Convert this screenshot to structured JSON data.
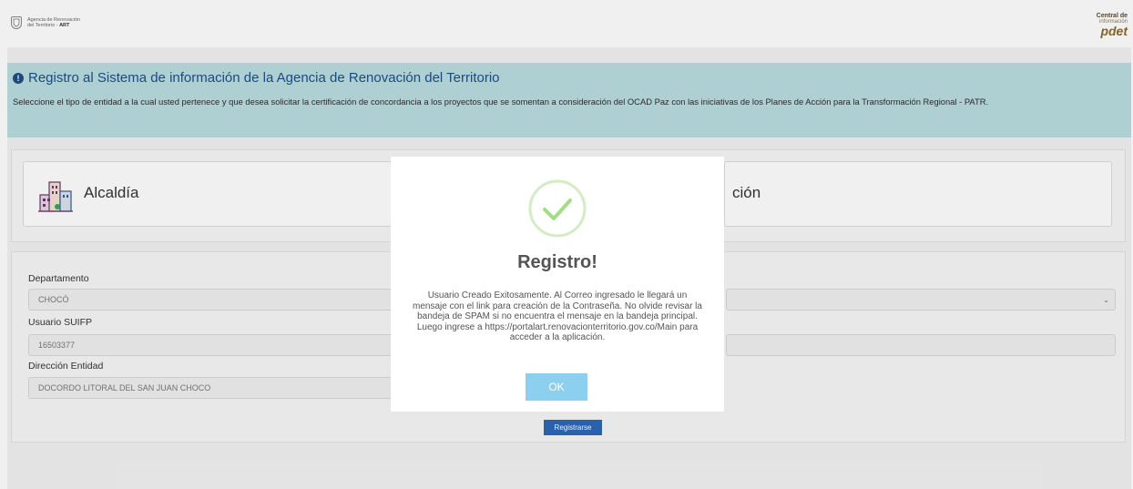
{
  "header": {
    "left_logo": {
      "line1": "Agencia de Renovación",
      "line2": "del Territorio - ",
      "line2_bold": "ART"
    },
    "right_logo": {
      "line1": "Central de",
      "line2": "información",
      "line3": "pdet"
    }
  },
  "banner": {
    "title": "Registro al Sistema de información de la Agencia de Renovación del Territorio",
    "text": "Seleccione el tipo de entidad a la cual usted pertenece y que desea solicitar la certificación de concordancia a los proyectos que se somentan a consideración del OCAD Paz con las iniciativas de los Planes de Acción para la Transformación Regional - PATR."
  },
  "entities": [
    {
      "label": "Alcaldía",
      "icon": "building-icon"
    },
    {
      "label": "ción"
    }
  ],
  "form": {
    "departamento_label": "Departamento",
    "departamento_value": "CHOCÓ",
    "usuario_label": "Usuario SUIFP",
    "usuario_value": "16503377",
    "direccion_label": "Dirección Entidad",
    "direccion_value": "DOCORDO LITORAL DEL SAN JUAN CHOCO",
    "register_button": "Registrarse"
  },
  "modal": {
    "title": "Registro!",
    "message": "Usuario Creado Exitosamente. Al Correo ingresado le llegará un mensaje con el link para creación de la Contraseña. No olvide revisar la bandeja de SPAM si no encuentra el mensaje en la bandeja principal. Luego ingrese a https://portalart.renovacionterritorio.gov.co/Main para acceder a la aplicación.",
    "ok_button": "OK"
  },
  "colors": {
    "banner_bg": "#b9dde1",
    "title_blue": "#1d4f8a",
    "success_green": "#a5dc86",
    "ok_button": "#8ccfee",
    "register_button": "#2c68b8"
  }
}
